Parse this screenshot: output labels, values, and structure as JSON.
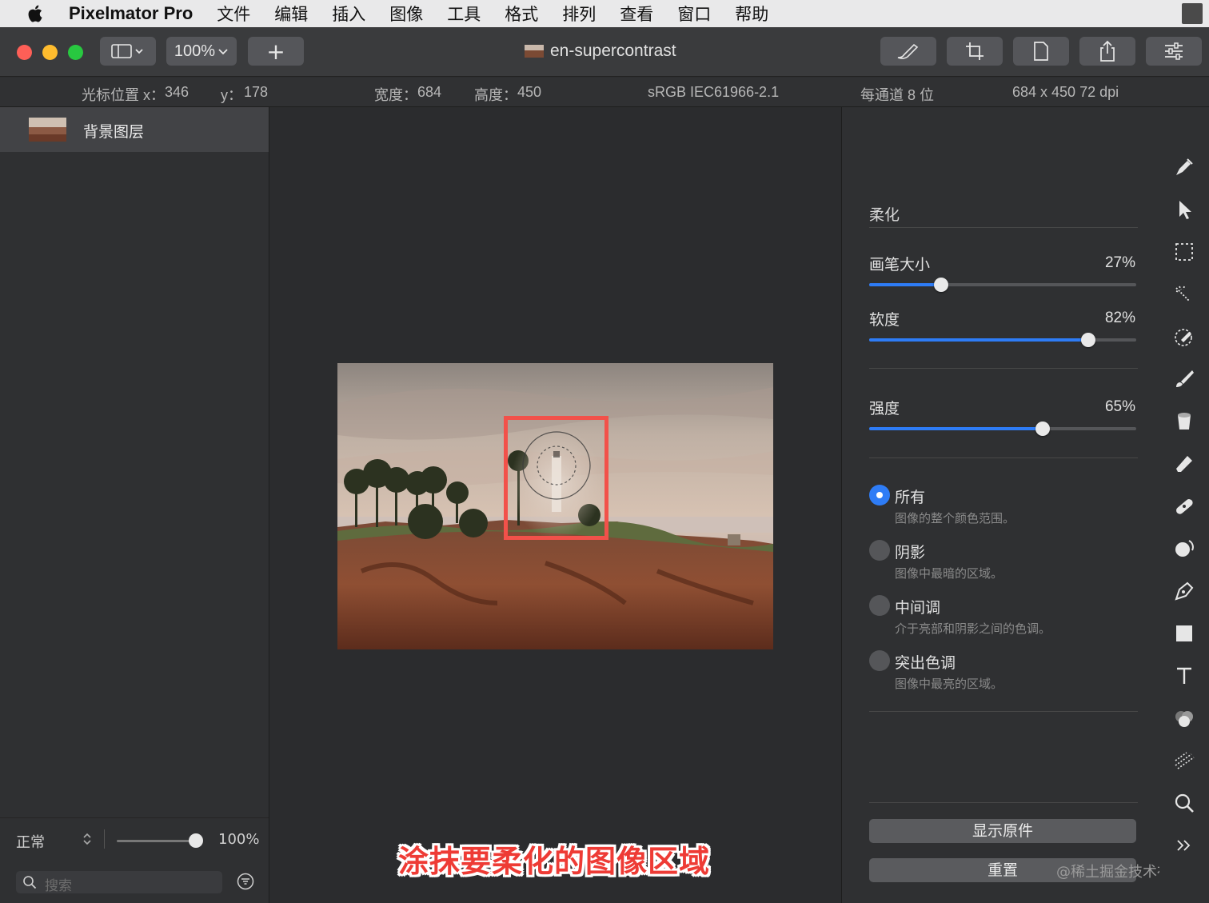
{
  "menubar": {
    "app_name": "Pixelmator Pro",
    "items": [
      "文件",
      "编辑",
      "插入",
      "图像",
      "工具",
      "格式",
      "排列",
      "查看",
      "窗口",
      "帮助"
    ]
  },
  "toolbar": {
    "zoom": "100%",
    "add_label": "+",
    "document_title": "en-supercontrast"
  },
  "infobar": {
    "cursor_label": "光标位置 x：",
    "cursor_x": "346",
    "y_label": "y：",
    "cursor_y": "178",
    "width_label": "宽度：",
    "width": "684",
    "height_label": "高度：",
    "height": "450",
    "color_profile": "sRGB IEC61966-2.1",
    "bit_depth": "每通道 8 位",
    "dimensions": "684 x 450 72 dpi"
  },
  "layers": {
    "items": [
      {
        "name": "背景图层"
      }
    ],
    "blend_mode": "正常",
    "opacity": "100%",
    "opacity_fraction": 1.0,
    "search_placeholder": "搜索"
  },
  "canvas": {
    "caption": "涂抹要柔化的图像区域"
  },
  "inspector": {
    "tool_name": "柔化",
    "sliders": [
      {
        "label": "画笔大小",
        "value": "27%",
        "fraction": 0.27
      },
      {
        "label": "软度",
        "value": "82%",
        "fraction": 0.82
      },
      {
        "label": "强度",
        "value": "65%",
        "fraction": 0.65
      }
    ],
    "ranges": [
      {
        "label": "所有",
        "desc": "图像的整个颜色范围。",
        "selected": true
      },
      {
        "label": "阴影",
        "desc": "图像中最暗的区域。",
        "selected": false
      },
      {
        "label": "中间调",
        "desc": "介于亮部和阴影之间的色调。",
        "selected": false
      },
      {
        "label": "突出色调",
        "desc": "图像中最亮的区域。",
        "selected": false
      }
    ],
    "show_original_label": "显示原件",
    "reset_label": "重置",
    "watermark": "@稀土掘金技术社区"
  },
  "tools": [
    "paint-style-icon",
    "arrange-pointer-icon",
    "selection-icon",
    "magic-select-icon",
    "color-picker-icon",
    "paint-brush-icon",
    "paint-bucket-icon",
    "eraser-icon",
    "repair-icon",
    "retouch-icon",
    "pen-icon",
    "shape-icon",
    "type-icon",
    "color-adjust-icon",
    "distort-icon",
    "zoom-icon",
    "more-tools-icon"
  ],
  "colors": {
    "accent": "#2e7cf6",
    "highlight": "#f2514a",
    "caption": "#ee3b35"
  }
}
